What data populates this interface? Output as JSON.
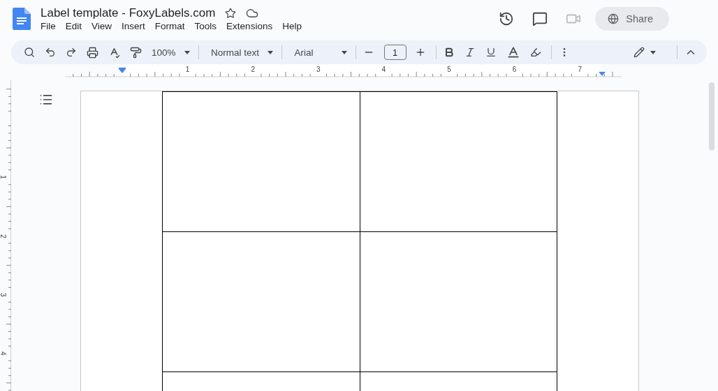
{
  "document": {
    "title": "Label template - FoxyLabels.com"
  },
  "menu": [
    "File",
    "Edit",
    "View",
    "Insert",
    "Format",
    "Tools",
    "Extensions",
    "Help"
  ],
  "share": {
    "label": "Share"
  },
  "toolbar": {
    "zoom": "100%",
    "style": "Normal text",
    "font": "Arial",
    "font_size": "1"
  },
  "ruler": {
    "horizontal": [
      "1",
      "2",
      "3",
      "4",
      "5",
      "6",
      "7"
    ],
    "vertical": [
      "1",
      "2",
      "3",
      "4"
    ]
  },
  "table": {
    "rows": [
      {
        "cells": [
          {
            "kind": "empty"
          },
          {
            "kind": "empty"
          }
        ]
      },
      {
        "cells": [
          {
            "kind": "empty"
          },
          {
            "kind": "empty"
          }
        ]
      },
      {
        "cells": [
          {
            "kind": "empty"
          },
          {
            "kind": "empty"
          }
        ]
      }
    ]
  }
}
